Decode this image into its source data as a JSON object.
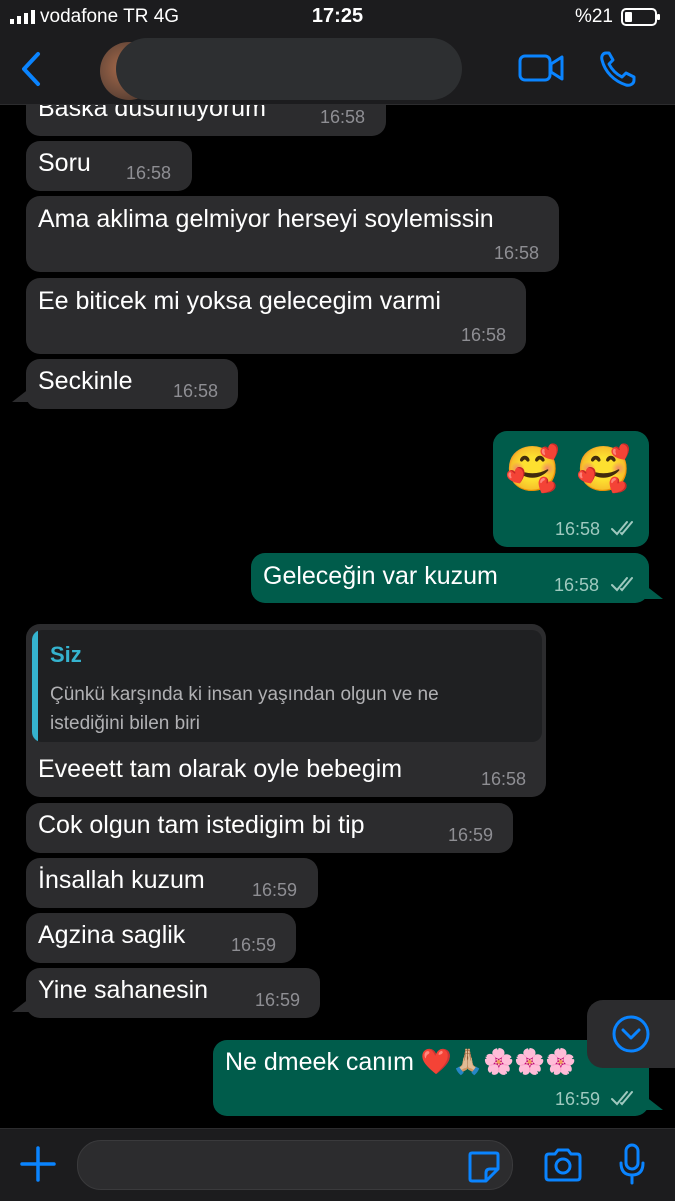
{
  "status_bar": {
    "carrier": "vodafone TR  4G",
    "time": "17:25",
    "battery": "%21"
  },
  "header": {
    "contact_name": "",
    "icons": [
      "back-chevron-icon",
      "video-call-icon",
      "phone-call-icon"
    ]
  },
  "messages": [
    {
      "dir": "in",
      "text": "Baska dusunuyorum",
      "time": "16:58"
    },
    {
      "dir": "in",
      "text": "Soru",
      "time": "16:58"
    },
    {
      "dir": "in",
      "text": "Ama aklima gelmiyor herseyi soylemissin",
      "time": "16:58"
    },
    {
      "dir": "in",
      "text": "Ee biticek mi yoksa gelecegim varmi",
      "time": "16:58"
    },
    {
      "dir": "in",
      "text": "Seckinle",
      "time": "16:58"
    },
    {
      "dir": "out",
      "text": "🥰 🥰",
      "time": "16:58",
      "status": "read"
    },
    {
      "dir": "out",
      "text": "Geleceğin var kuzum",
      "time": "16:58",
      "status": "read"
    },
    {
      "dir": "in",
      "text": "Eveeett tam olarak oyle bebegim",
      "time": "16:58",
      "quote": {
        "author": "Siz",
        "line1": "Çünkü karşında ki insan yaşından olgun ve ne",
        "line2": "istediğini bilen biri"
      }
    },
    {
      "dir": "in",
      "text": "Cok olgun tam istedigim bi tip",
      "time": "16:59"
    },
    {
      "dir": "in",
      "text": "İnsallah kuzum",
      "time": "16:59"
    },
    {
      "dir": "in",
      "text": "Agzina saglik",
      "time": "16:59"
    },
    {
      "dir": "in",
      "text": "Yine sahanesin",
      "time": "16:59"
    },
    {
      "dir": "out",
      "text": "Ne dmeek canım ❤️🙏🏼🌸🌸🌸",
      "time": "16:59",
      "status": "read"
    }
  ],
  "composer": {
    "placeholder": "",
    "icons": [
      "plus-icon",
      "sticker-icon",
      "camera-icon",
      "microphone-icon"
    ]
  },
  "colors": {
    "incoming_bubble": "#2c2c2e",
    "outgoing_bubble": "#005c4b",
    "accent": "#0a84ff",
    "quote_accent": "#35b3cf"
  }
}
